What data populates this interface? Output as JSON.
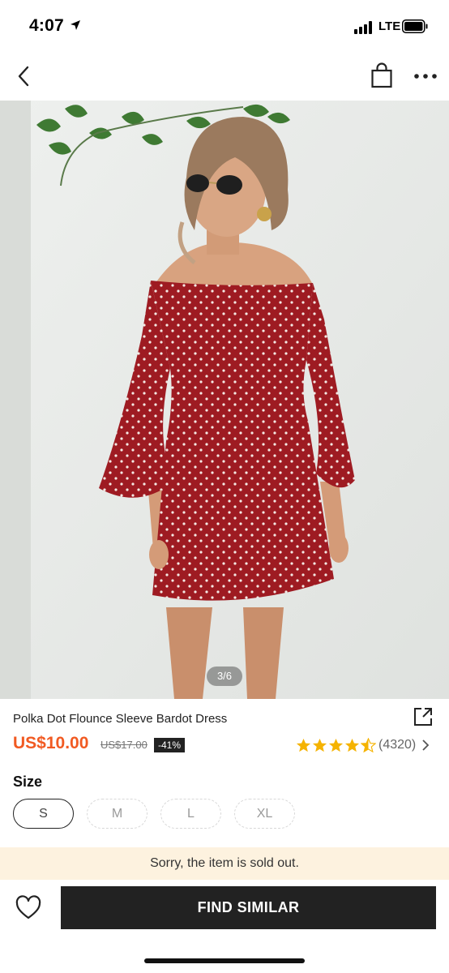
{
  "status_bar": {
    "time": "4:07",
    "network": "LTE",
    "icons": [
      "location-arrow-icon",
      "signal-icon",
      "battery-icon"
    ]
  },
  "nav": {
    "icons": [
      "back-chevron-icon",
      "shopping-bag-icon",
      "more-icon"
    ]
  },
  "gallery": {
    "counter": "3/6",
    "current": 3,
    "total": 6
  },
  "product": {
    "title": "Polka Dot Flounce Sleeve Bardot Dress",
    "price": "US$10.00",
    "original_price": "US$17.00",
    "discount": "-41%",
    "rating_value": 4.5,
    "rating_count": "(4320)"
  },
  "size": {
    "label": "Size",
    "options": [
      {
        "label": "S",
        "selected": true,
        "available": true
      },
      {
        "label": "M",
        "selected": false,
        "available": false
      },
      {
        "label": "L",
        "selected": false,
        "available": false
      },
      {
        "label": "XL",
        "selected": false,
        "available": false
      }
    ]
  },
  "notice": {
    "sold_out": "Sorry, the item is sold out."
  },
  "bottom_bar": {
    "find_similar": "FIND SIMILAR"
  },
  "colors": {
    "price": "#f15a22",
    "star": "#f5b301",
    "notice_bg": "#fdf2df",
    "button_bg": "#222222",
    "dress": "#9e1b22"
  }
}
